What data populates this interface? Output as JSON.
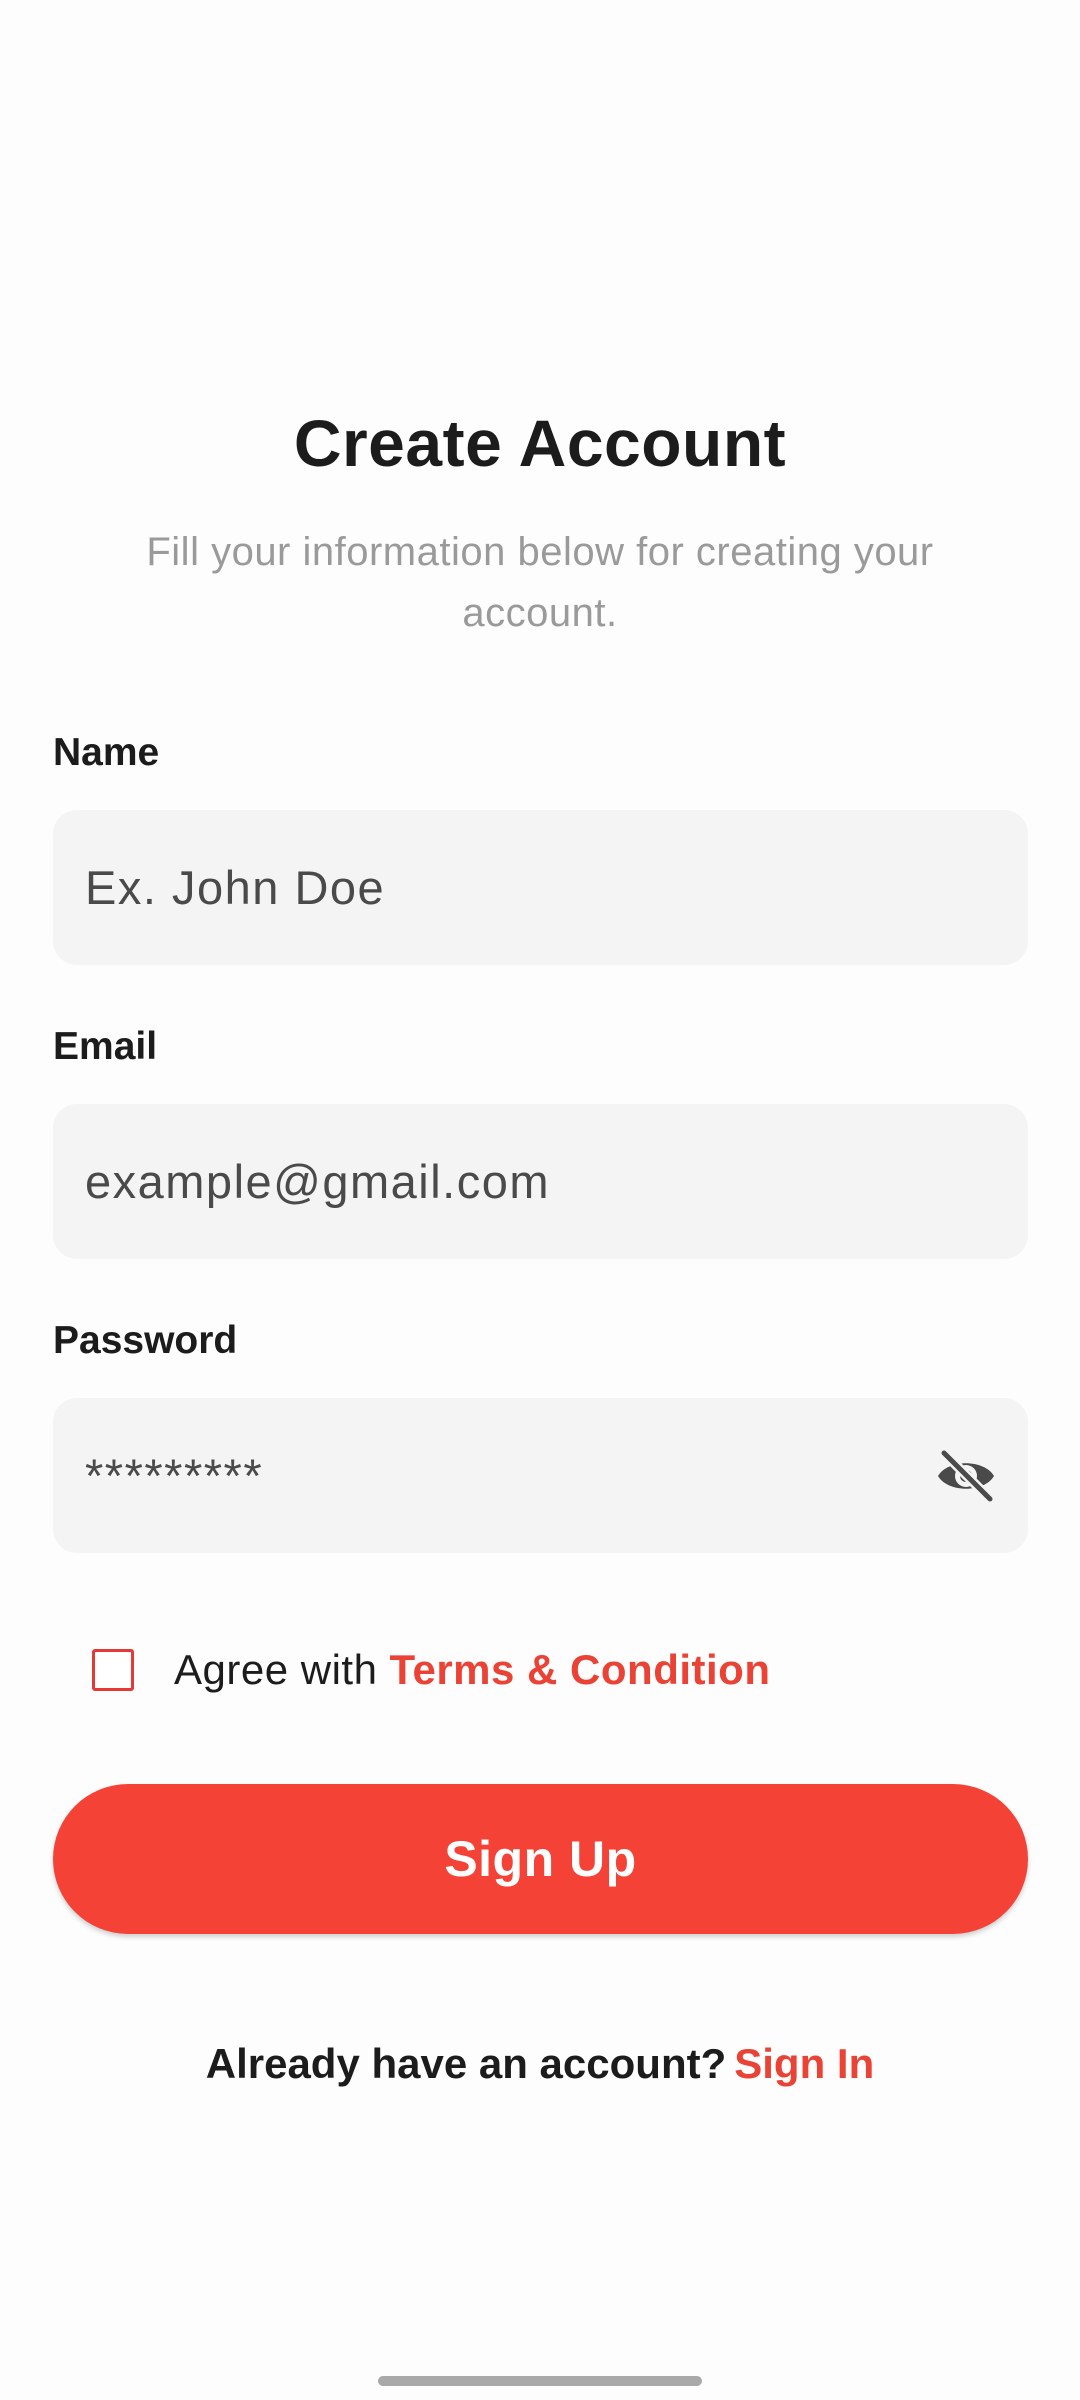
{
  "header": {
    "title": "Create Account",
    "subtitle": "Fill your information below for creating your account."
  },
  "form": {
    "name": {
      "label": "Name",
      "placeholder": "Ex. John Doe"
    },
    "email": {
      "label": "Email",
      "placeholder": "example@gmail.com"
    },
    "password": {
      "label": "Password",
      "value": "*********",
      "toggle_icon": "eye-off-icon"
    },
    "terms": {
      "checked": false,
      "prefix": "Agree with",
      "link_label": "Terms & Condition"
    },
    "submit_label": "Sign Up"
  },
  "footer": {
    "prompt": "Already have an account?",
    "link_label": "Sign In"
  },
  "colors": {
    "accent": "#f44336",
    "link": "#ea4335",
    "field_bg": "#f4f4f4",
    "subtitle": "#9a9a9a"
  }
}
